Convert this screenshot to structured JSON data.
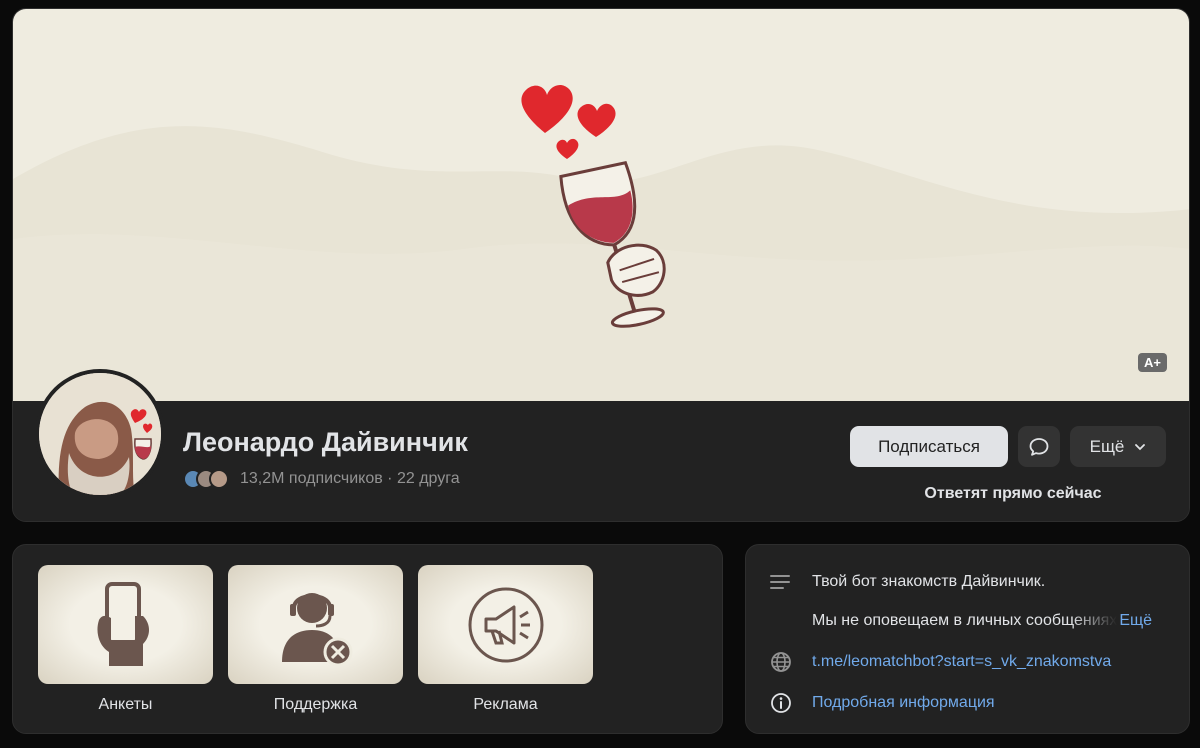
{
  "cover": {
    "font_badge": "A+",
    "illustration": "wine-glass-with-hearts"
  },
  "profile": {
    "name": "Леонардо Дайвинчик",
    "meta": "13,2M подписчиков · 22 друга",
    "avatar": "leonardo-portrait-with-wine-and-hearts",
    "friends_avatars_count": 3
  },
  "actions": {
    "subscribe_label": "Подписаться",
    "message_icon": "chat-bubble-icon",
    "more_label": "Ещё",
    "reply_status": "Ответят прямо сейчас"
  },
  "apps": [
    {
      "label": "Анкеты",
      "icon": "phone-in-hand-icon"
    },
    {
      "label": "Поддержка",
      "icon": "support-agent-icon"
    },
    {
      "label": "Реклама",
      "icon": "megaphone-icon"
    }
  ],
  "about": {
    "description": "Твой бот знакомств Дайвинчик.",
    "notice": "Мы не оповещаем в личных сообщениях",
    "notice_more": "Ещё",
    "link": "t.me/leomatchbot?start=s_vk_znakomstva",
    "details_label": "Подробная информация"
  },
  "colors": {
    "background": "#0a0a0a",
    "card": "#222222",
    "cover": "#efece0",
    "accent_link": "#71aaeb",
    "wine": "#b8394a",
    "heart": "#e0282d"
  }
}
